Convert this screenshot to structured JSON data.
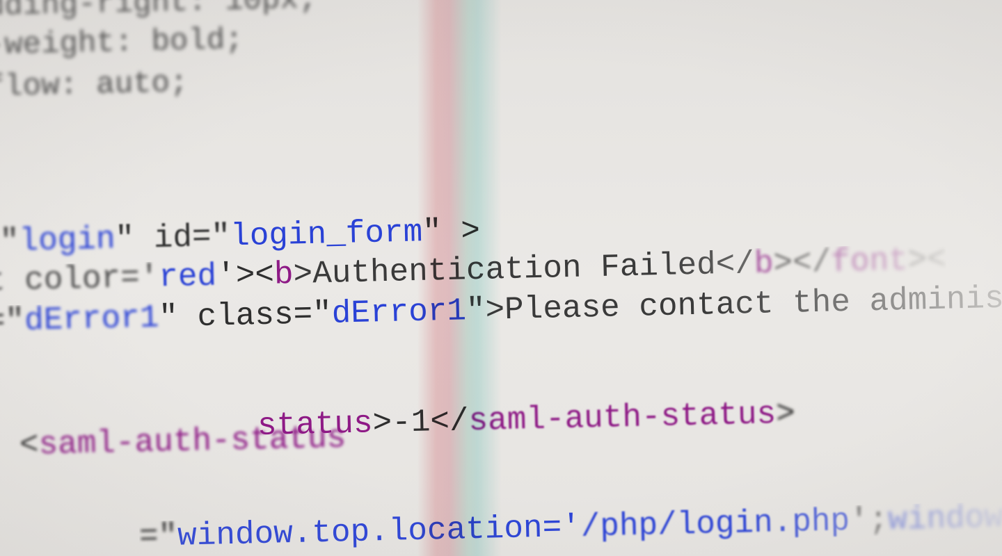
{
  "code": {
    "l1": {
      "a": "dding-right: 10px;"
    },
    "l2": {
      "a": "-weight: bold;"
    },
    "l3": {
      "a": "flow: auto;"
    },
    "l4": {
      "a": "\"",
      "b": "login",
      "c": "\" id=\"",
      "d": "login_form",
      "e": "\" >"
    },
    "l5": {
      "a": "t color='",
      "b": "red",
      "c": "'><",
      "d": "b",
      "e": ">Authentication Failed</",
      "f": "b",
      "g": "></",
      "h": "font",
      "i": "><"
    },
    "l6": {
      "a": "=\"",
      "b": "dError1",
      "c": "\" class=\"",
      "d": "dError1",
      "e": "\">Please contact the administ"
    },
    "l7": {
      "a": "status",
      "b": ">-1</",
      "c": "saml-auth-status",
      "d": ">"
    },
    "l8": {
      "a": "<",
      "b": "saml-auth-status",
      "c": ">"
    },
    "l9": {
      "a": "=\"",
      "b": "window.top.location='",
      "c": "/php/login.php",
      "d": "';",
      "e": "window"
    }
  },
  "colors": {
    "background": "#e6e4e1",
    "plain": "#4a4a4a",
    "string": "#2a42d6",
    "tag": "#8e1a86",
    "aberration_red": "#d86a7a",
    "aberration_cyan": "#5ac8be"
  }
}
